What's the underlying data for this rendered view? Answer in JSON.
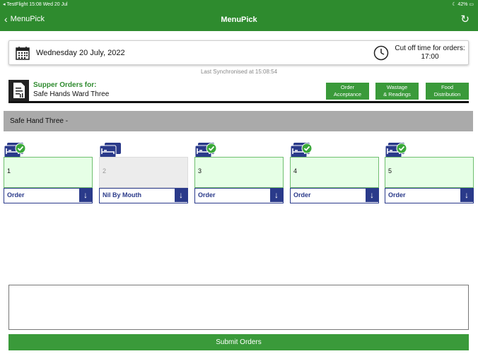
{
  "status_bar": {
    "left": "◂ TestFlight  15:08  Wed 20 Jul",
    "right": "☾ 42% ▭"
  },
  "nav": {
    "back_label": "MenuPick",
    "title": "MenuPick",
    "refresh_icon": "refresh-icon"
  },
  "date_card": {
    "date": "Wednesday 20 July, 2022",
    "cutoff_label": "Cut off time for orders:",
    "cutoff_time": "17:00"
  },
  "last_sync": "Last Synchronised at 15:08:54",
  "supper": {
    "title": "Supper Orders for:",
    "ward": "Safe Hands Ward Three",
    "buttons": [
      {
        "line1": "Order",
        "line2": "Acceptance"
      },
      {
        "line1": "Wastage",
        "line2": "& Readings"
      },
      {
        "line1": "Food",
        "line2": "Distribution"
      }
    ]
  },
  "section_header": "Safe Hand Three -",
  "beds": [
    {
      "number": "1",
      "selection": "Order",
      "checked": true,
      "disabled": false
    },
    {
      "number": "2",
      "selection": "Nil By Mouth",
      "checked": false,
      "disabled": true
    },
    {
      "number": "3",
      "selection": "Order",
      "checked": true,
      "disabled": false
    },
    {
      "number": "4",
      "selection": "Order",
      "checked": true,
      "disabled": false
    },
    {
      "number": "5",
      "selection": "Order",
      "checked": true,
      "disabled": false
    }
  ],
  "notes": {
    "value": ""
  },
  "submit_label": "Submit Orders",
  "colors": {
    "brand_green": "#2e8b2e",
    "button_green": "#3a9a3a",
    "select_blue": "#2a3a8a",
    "bed_card_green": "#e6ffe6"
  }
}
